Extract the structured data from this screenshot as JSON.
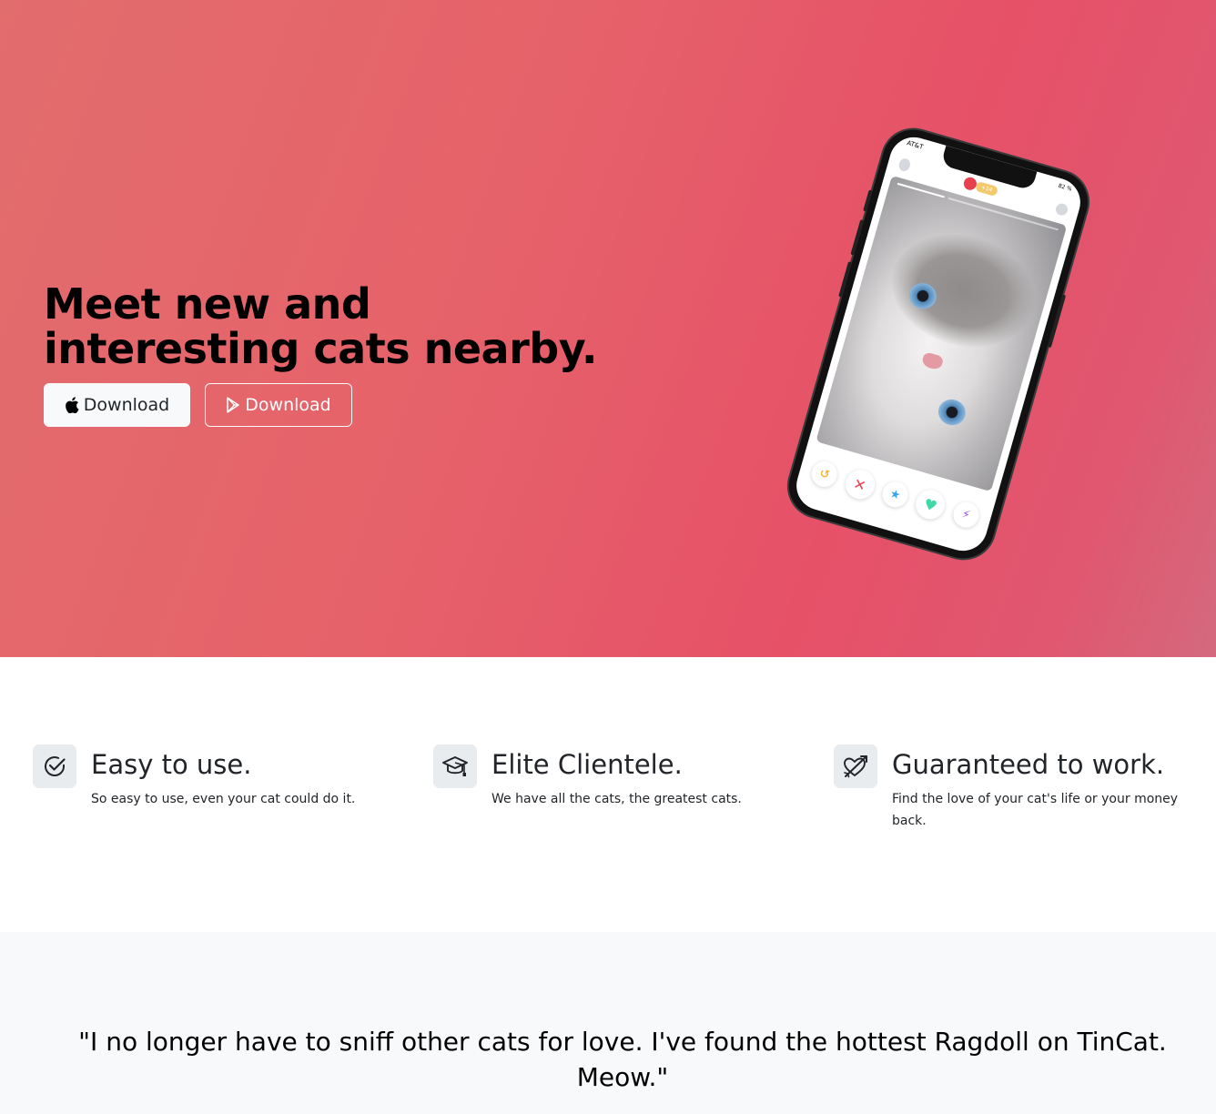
{
  "hero": {
    "title": "Meet new and interesting cats nearby.",
    "buttons": {
      "apple": {
        "label": "Download",
        "icon": "apple-icon"
      },
      "play": {
        "label": "Download",
        "icon": "google-play-icon"
      }
    },
    "phone": {
      "carrier": "AT&T",
      "battery": "82 %",
      "pill": "+14"
    },
    "colors": {
      "gradient_start": "#e26d6d",
      "gradient_mid": "#e65168",
      "gradient_end": "#d4697e"
    }
  },
  "features": [
    {
      "icon": "check-circle-icon",
      "title": "Easy to use.",
      "description": "So easy to use, even your cat could do it."
    },
    {
      "icon": "graduation-cap-icon",
      "title": "Elite Clientele.",
      "description": "We have all the cats, the greatest cats."
    },
    {
      "icon": "heart-arrow-icon",
      "title": "Guaranteed to work.",
      "description": "Find the love of your cat's life or your money back."
    }
  ],
  "testimonial": {
    "quote": "\"I no longer have to sniff other cats for love. I've found the hottest Ragdoll on TinCat. Meow.\""
  }
}
